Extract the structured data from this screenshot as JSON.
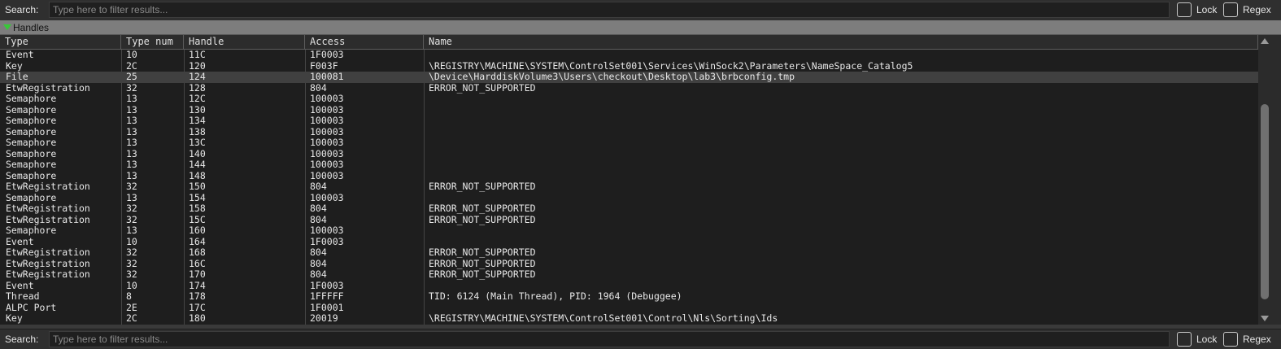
{
  "top_search": {
    "label": "Search:",
    "placeholder": "Type here to filter results...",
    "lock_label": "Lock",
    "regex_label": "Regex"
  },
  "bottom_search": {
    "label": "Search:",
    "placeholder": "Type here to filter results...",
    "lock_label": "Lock",
    "regex_label": "Regex"
  },
  "group": {
    "label": "Handles"
  },
  "columns": [
    "Type",
    "Type num",
    "Handle",
    "Access",
    "Name"
  ],
  "rows": [
    {
      "type": "Event",
      "typenum": "10",
      "handle": "11C",
      "access": "1F0003",
      "name": ""
    },
    {
      "type": "Key",
      "typenum": "2C",
      "handle": "120",
      "access": "F003F",
      "name": "\\REGISTRY\\MACHINE\\SYSTEM\\ControlSet001\\Services\\WinSock2\\Parameters\\NameSpace_Catalog5"
    },
    {
      "type": "File",
      "typenum": "25",
      "handle": "124",
      "access": "100081",
      "name": "\\Device\\HarddiskVolume3\\Users\\checkout\\Desktop\\lab3\\brbconfig.tmp"
    },
    {
      "type": "EtwRegistration",
      "typenum": "32",
      "handle": "128",
      "access": "804",
      "name": "ERROR_NOT_SUPPORTED"
    },
    {
      "type": "Semaphore",
      "typenum": "13",
      "handle": "12C",
      "access": "100003",
      "name": ""
    },
    {
      "type": "Semaphore",
      "typenum": "13",
      "handle": "130",
      "access": "100003",
      "name": ""
    },
    {
      "type": "Semaphore",
      "typenum": "13",
      "handle": "134",
      "access": "100003",
      "name": ""
    },
    {
      "type": "Semaphore",
      "typenum": "13",
      "handle": "138",
      "access": "100003",
      "name": ""
    },
    {
      "type": "Semaphore",
      "typenum": "13",
      "handle": "13C",
      "access": "100003",
      "name": ""
    },
    {
      "type": "Semaphore",
      "typenum": "13",
      "handle": "140",
      "access": "100003",
      "name": ""
    },
    {
      "type": "Semaphore",
      "typenum": "13",
      "handle": "144",
      "access": "100003",
      "name": ""
    },
    {
      "type": "Semaphore",
      "typenum": "13",
      "handle": "148",
      "access": "100003",
      "name": ""
    },
    {
      "type": "EtwRegistration",
      "typenum": "32",
      "handle": "150",
      "access": "804",
      "name": "ERROR_NOT_SUPPORTED"
    },
    {
      "type": "Semaphore",
      "typenum": "13",
      "handle": "154",
      "access": "100003",
      "name": ""
    },
    {
      "type": "EtwRegistration",
      "typenum": "32",
      "handle": "158",
      "access": "804",
      "name": "ERROR_NOT_SUPPORTED"
    },
    {
      "type": "EtwRegistration",
      "typenum": "32",
      "handle": "15C",
      "access": "804",
      "name": "ERROR_NOT_SUPPORTED"
    },
    {
      "type": "Semaphore",
      "typenum": "13",
      "handle": "160",
      "access": "100003",
      "name": ""
    },
    {
      "type": "Event",
      "typenum": "10",
      "handle": "164",
      "access": "1F0003",
      "name": ""
    },
    {
      "type": "EtwRegistration",
      "typenum": "32",
      "handle": "168",
      "access": "804",
      "name": "ERROR_NOT_SUPPORTED"
    },
    {
      "type": "EtwRegistration",
      "typenum": "32",
      "handle": "16C",
      "access": "804",
      "name": "ERROR_NOT_SUPPORTED"
    },
    {
      "type": "EtwRegistration",
      "typenum": "32",
      "handle": "170",
      "access": "804",
      "name": "ERROR_NOT_SUPPORTED"
    },
    {
      "type": "Event",
      "typenum": "10",
      "handle": "174",
      "access": "1F0003",
      "name": ""
    },
    {
      "type": "Thread",
      "typenum": "8",
      "handle": "178",
      "access": "1FFFFF",
      "name": "TID: 6124 (Main Thread), PID: 1964 (Debuggee)"
    },
    {
      "type": "ALPC Port",
      "typenum": "2E",
      "handle": "17C",
      "access": "1F0001",
      "name": ""
    },
    {
      "type": "Key",
      "typenum": "2C",
      "handle": "180",
      "access": "20019",
      "name": "\\REGISTRY\\MACHINE\\SYSTEM\\ControlSet001\\Control\\Nls\\Sorting\\Ids"
    }
  ],
  "selected_row": 2
}
